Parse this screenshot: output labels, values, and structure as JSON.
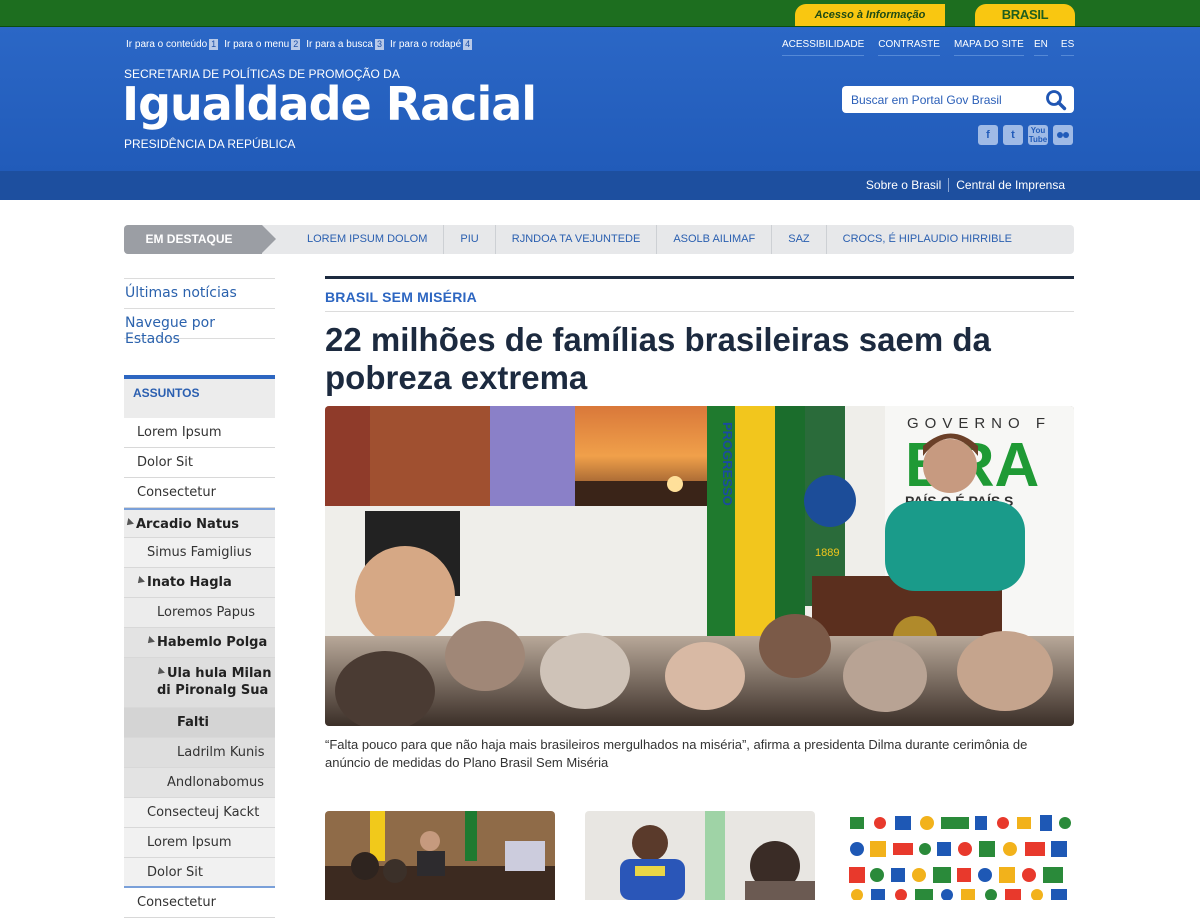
{
  "govbar": {
    "acesso": "Acesso à Informação",
    "brasil": "BRASIL"
  },
  "header": {
    "skip": [
      {
        "label": "Ir para o conteúdo",
        "key": "1"
      },
      {
        "label": "Ir para o menu",
        "key": "2"
      },
      {
        "label": "Ir para a busca",
        "key": "3"
      },
      {
        "label": "Ir para o rodapé",
        "key": "4"
      }
    ],
    "toplinks": [
      "ACESSIBILIDADE",
      "CONTRASTE",
      "MAPA DO SITE"
    ],
    "langs": [
      "EN",
      "ES"
    ],
    "org_pre": "SECRETARIA DE POLÍTICAS DE PROMOÇÃO DA",
    "org_name": "Igualdade Racial",
    "org_post": "PRESIDÊNCIA DA REPÚBLICA",
    "search_placeholder": "Buscar em Portal Gov Brasil",
    "social": [
      "facebook-icon",
      "twitter-icon",
      "youtube-icon",
      "flickr-icon"
    ]
  },
  "servbar": {
    "links": [
      "Sobre o Brasil",
      "Central de Imprensa"
    ]
  },
  "destaque": {
    "label": "EM DESTAQUE",
    "items": [
      "LOREM IPSUM DOLOM",
      "PIU",
      "RJNDOA TA VEJUNTEDE",
      "ASOLB AILIMAF",
      "SAZ",
      "CROCS, É HIPLAUDIO HIRRIBLE"
    ]
  },
  "sidebar": {
    "links": [
      "Últimas notícias",
      "Navegue por Estados"
    ],
    "assuntos": "ASSUNTOS",
    "menu": [
      "Lorem Ipsum",
      "Dolor Sit",
      "Consectetur",
      "Arcadio Natus",
      "Simus Famiglius",
      "Inato Hagla",
      "Loremos Papus",
      "Habemlo Polga",
      "Ula hula Milan di Pironalg Sua",
      "Falti",
      "Ladrilm Kunis",
      "Andlonabomus",
      "Consecteuj Kackt",
      "Lorem Ipsum",
      "Dolor Sit",
      "Consectetur"
    ]
  },
  "main": {
    "kicker": "BRASIL SEM MISÉRIA",
    "headline": "22 milhões de famílias brasileiras saem da pobreza extrema",
    "photo": {
      "banner_top": "GOVERNO F",
      "banner_mid": "BRA",
      "banner_bottom": "PAÍS   O É PAÍS S",
      "flag_text": "PROGRESSO",
      "year": "1889"
    },
    "caption": "“Falta pouco para que não haja mais brasileiros mergulhados na miséria”, afirma a presidenta Dilma durante cerimônia de anúncio de medidas do Plano Brasil Sem Miséria"
  },
  "colors": {
    "header_blue": "#2b67c6",
    "gov_green": "#1d6e1f",
    "gov_yellow": "#f9c711",
    "link_blue": "#2b62ad"
  }
}
